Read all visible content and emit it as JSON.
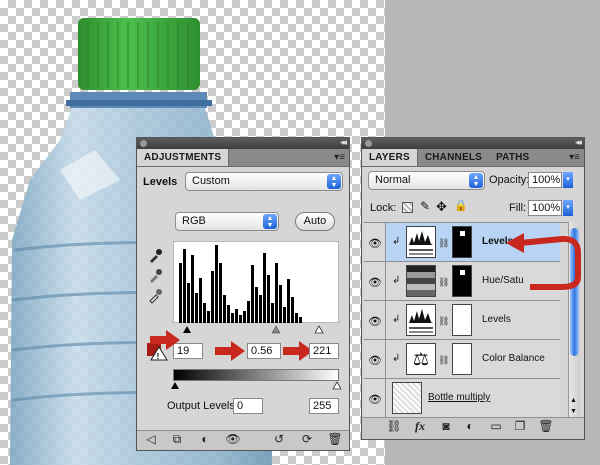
{
  "colors": {
    "canvas_check": "#cccccc",
    "pasteboard": "#b7b7b7",
    "panel_bg": "#d6d6d6",
    "selected_row": "#b9d3f5",
    "red_arrow": "#c8281e",
    "cap_green": "#3aa43a"
  },
  "adjustments": {
    "tab_label": "ADJUSTMENTS",
    "type_label": "Levels",
    "preset_value": "Custom",
    "channel_value": "RGB",
    "auto_label": "Auto",
    "input_black": "19",
    "input_gamma": "0.56",
    "input_white": "221",
    "output_label": "Output Levels:",
    "output_black": "0",
    "output_white": "255",
    "input_levels_values": [
      19,
      0.56,
      221
    ],
    "output_levels_values": [
      0,
      255
    ]
  },
  "layers_panel": {
    "tabs": [
      "LAYERS",
      "CHANNELS",
      "PATHS"
    ],
    "blend_mode": "Normal",
    "opacity_label": "Opacity:",
    "opacity_value": "100%",
    "lock_label": "Lock:",
    "fill_label": "Fill:",
    "fill_value": "100%",
    "layers": [
      {
        "name": "Levels",
        "selected": true
      },
      {
        "name": "Hue/Satu",
        "selected": false
      },
      {
        "name": "Levels",
        "selected": false
      },
      {
        "name": "Color Balance",
        "selected": false
      },
      {
        "name": "Bottle multiply",
        "selected": false
      }
    ]
  },
  "icons": {
    "eye": "eye-icon",
    "link": "link-layers-icon",
    "fx": "fx-icon",
    "mask": "add-mask-icon",
    "adjust": "new-adjustment-icon",
    "group": "new-group-icon",
    "new_layer": "new-layer-icon",
    "trash": "trash-icon",
    "back": "back-arrow-icon",
    "clip": "clip-to-layer-icon",
    "visibility": "visibility-icon",
    "reset": "reset-icon",
    "previous": "previous-state-icon"
  },
  "footer_text": {
    "fx": "fx"
  }
}
